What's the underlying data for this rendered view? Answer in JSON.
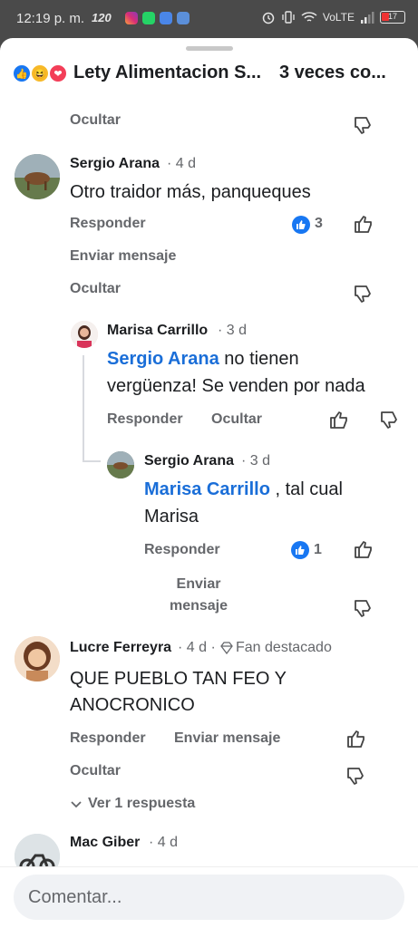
{
  "status_bar": {
    "time": "12:19 p. m.",
    "speed": "120",
    "network": "VoLTE",
    "battery": "17"
  },
  "header": {
    "title": "Lety Alimentacion S...",
    "reaction_count": "3 veces co..."
  },
  "top_actions": {
    "hide": "Ocultar"
  },
  "comments": [
    {
      "author": "Sergio Arana",
      "time": "· 4 d",
      "text": "Otro traidor más,  panqueques",
      "reply": "Responder",
      "likes": "3",
      "message": "Enviar mensaje",
      "hide": "Ocultar"
    },
    {
      "author": "Marisa Carrillo",
      "time": "· 3 d",
      "mention": "Sergio Arana",
      "text_line1": " no tienen",
      "text_line2": "vergüenza! Se venden por nada",
      "reply": "Responder",
      "hide": "Ocultar"
    },
    {
      "author": "Sergio Arana",
      "time": "· 3 d",
      "mention": "Marisa Carrillo",
      "text_line1": " , tal cual",
      "text_line2": "Marisa",
      "reply": "Responder",
      "likes": "1",
      "message_line1": "Enviar",
      "message_line2": "mensaje"
    },
    {
      "author": "Lucre Ferreyra",
      "time": "· 4 d ·",
      "badge": "Fan destacado",
      "text_line1": "QUE PUEBLO TAN FEO Y",
      "text_line2": "ANOCRONICO",
      "reply": "Responder",
      "message": "Enviar mensaje",
      "hide": "Ocultar",
      "view_replies": "Ver 1 respuesta"
    },
    {
      "author": "Mac Giber",
      "time": "· 4 d"
    }
  ],
  "composer": {
    "placeholder": "Comentar..."
  },
  "colors": {
    "accent": "#1877f2",
    "mention": "#1a6ed8",
    "muted": "#65676b"
  },
  "icons": [
    "instagram-icon",
    "whatsapp-icon",
    "mail-icon",
    "vpn-icon",
    "alarm-icon",
    "vibrate-icon",
    "wifi-icon",
    "signal-icon",
    "battery-icon",
    "like-icon",
    "haha-icon",
    "love-icon",
    "thumbs-up-icon",
    "thumbs-down-icon",
    "diamond-icon",
    "chevron-down-icon"
  ]
}
